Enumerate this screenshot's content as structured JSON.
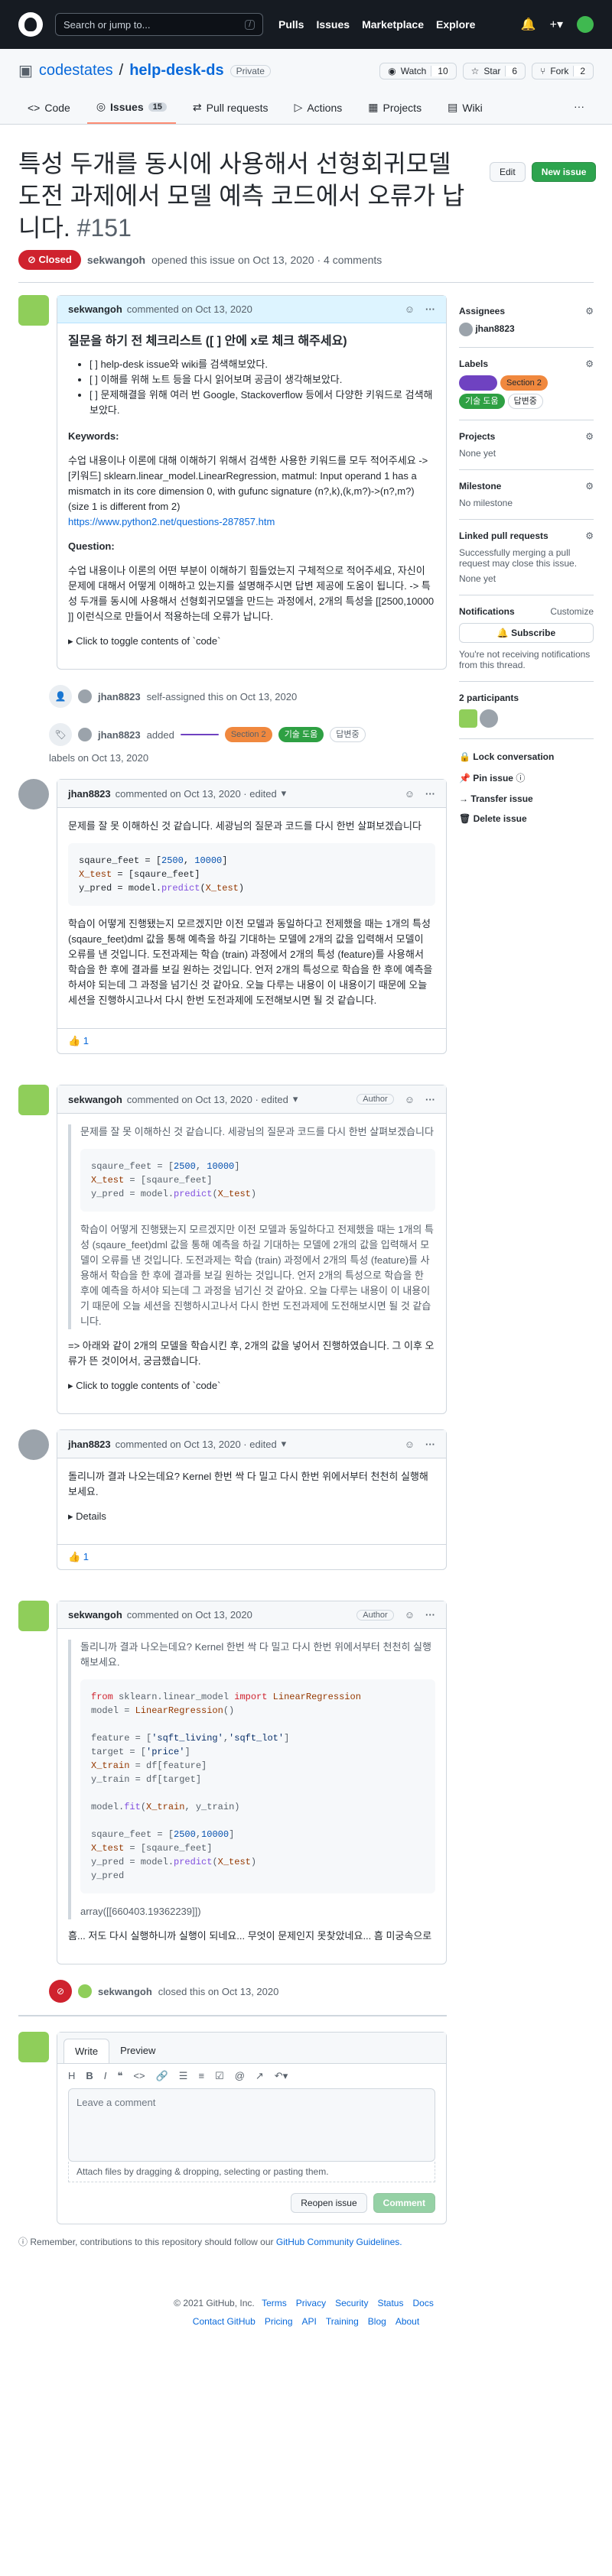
{
  "topnav": {
    "search_placeholder": "Search or jump to...",
    "slash": "/",
    "links": [
      "Pulls",
      "Issues",
      "Marketplace",
      "Explore"
    ]
  },
  "repo": {
    "owner": "codestates",
    "sep": "/",
    "name": "help-desk-ds",
    "visibility": "Private",
    "watch": "Watch",
    "watch_count": "10",
    "star": "Star",
    "star_count": "6",
    "fork": "Fork",
    "fork_count": "2"
  },
  "tabs": [
    {
      "label": "Code"
    },
    {
      "label": "Issues",
      "count": "15"
    },
    {
      "label": "Pull requests"
    },
    {
      "label": "Actions"
    },
    {
      "label": "Projects"
    },
    {
      "label": "Wiki"
    }
  ],
  "issue": {
    "title": "특성 두개를 동시에 사용해서 선형회귀모델 도전 과제에서 모델 예측 코드에서 오류가 납니다.",
    "number": "#151",
    "state": "Closed",
    "author": "sekwangoh",
    "meta": "opened this issue on Oct 13, 2020 · 4 comments",
    "edit": "Edit",
    "new_issue": "New issue"
  },
  "c1": {
    "author": "sekwangoh",
    "date": "commented on Oct 13, 2020",
    "h": "질문을 하기 전 체크리스트 ([ ] 안에 x로 체크 해주세요)",
    "checks": [
      "[ ] help-desk issue와 wiki를 검색해보았다.",
      "[ ] 이해를 위해 노트 등을 다시 읽어보며 공금이 생각해보았다.",
      "[ ] 문제해결을 위해 여러 번 Google, Stackoverflow 등에서 다양한 키워드로 검색해보았다."
    ],
    "kw_h": "Keywords:",
    "kw": "수업 내용이나 이론에 대해 이해하기 위해서 검색한 사용한 키워드를 모두 적어주세요 -> [키워드] sklearn.linear_model.LinearRegression, matmul: Input operand 1 has a mismatch in its core dimension 0, with gufunc signature (n?,k),(k,m?)->(n?,m?) (size 1 is different from 2)",
    "link": "https://www.python2.net/questions-287857.htm",
    "q_h": "Question:",
    "q": "수업 내용이나 이론의 어떤 부분이 이해하기 힘들었는지 구체적으로 적어주세요, 자신이 문제에 대해서 어떻게 이해하고 있는지를 설명해주시면 답변 제공에 도움이 됩니다. -> 특성 두개를 동시에 사용해서 선형회귀모델을 만드는 과정에서, 2개의 특성을 [[2500,10000 ]] 이런식으로 만들어서 적용하는데 오류가 납니다.",
    "toggle": "Click to toggle contents of `code`"
  },
  "e1": {
    "user": "jhan8823",
    "text": "self-assigned this on Oct 13, 2020"
  },
  "e2": {
    "user": "jhan8823",
    "added": "added",
    "labels": [
      {
        "name": "",
        "color": "#6f42c1",
        "fg": "#fff"
      },
      {
        "name": "Section 2",
        "color": "#f0883e",
        "fg": "#24292f"
      },
      {
        "name": "기술 도움",
        "color": "#2ea043",
        "fg": "#fff"
      },
      {
        "name": "답변중",
        "color": "#eaeef2",
        "fg": "#24292f"
      }
    ],
    "tail": "labels on Oct 13, 2020"
  },
  "c2": {
    "author": "jhan8823",
    "date": "commented on Oct 13, 2020 · edited",
    "p1": "문제를 잘 못 이해하신 것 같습니다. 세광님의 질문과 코드를 다시 한번 살펴보겠습니다",
    "p2": "학습이 어떻게 진행됐는지 모르겠지만 이전 모델과 동일하다고 전제했을 때는 1개의 특성 (sqaure_feet)dml 값을 통해 예측을 하길 기대하는 모델에 2개의 값을 입력해서 모델이 오류를 낸 것입니다. 도전과제는 학습 (train) 과정에서 2개의 특성 (feature)를 사용해서 학습을 한 후에 결과를 보길 원하는 것입니다. 언저 2개의 특성으로 학습을 한 후에 예측을 하셔야 되는데 그 과정을 넘기신 것 같아요. 오늘 다루는 내용이 이 내용이기 때문에 오늘 세션을 진행하시고나서 다시 한번 도전과제에 도전해보시면 될 것 같습니다.",
    "react": "👍 1"
  },
  "c3": {
    "author": "sekwangoh",
    "date": "commented on Oct 13, 2020 · edited",
    "author_badge": "Author",
    "p": "=> 아래와 같이 2개의 모델을 학습시킨 후, 2개의 값을 넣어서 진행하였습니다. 그 이후 오류가 뜬 것이어서, 궁금했습니다.",
    "toggle": "Click to toggle contents of `code`"
  },
  "c4": {
    "author": "jhan8823",
    "date": "commented on Oct 13, 2020 · edited",
    "p": "돌리니까 결과 나오는데요? Kernel 한번 싹 다 밀고 다시 한번 위에서부터 천천히 실행해보세요.",
    "details": "Details",
    "react": "👍 1"
  },
  "c5": {
    "author": "sekwangoh",
    "date": "commented on Oct 13, 2020",
    "author_badge": "Author",
    "out1": "array([[660403.19362239]])",
    "out2": "흠... 저도 다시 실행하니까 실행이 되네요... 무엇이 문제인지 못찾았네요... 흠 미궁속으로"
  },
  "e3": {
    "user": "sekwangoh",
    "text": "closed this on Oct 13, 2020"
  },
  "editor": {
    "write": "Write",
    "preview": "Preview",
    "placeholder": "Leave a comment",
    "attach": "Attach files by dragging & dropping, selecting or pasting them.",
    "reopen": "Reopen issue",
    "comment": "Comment",
    "reminder": "Remember, contributions to this repository should follow our",
    "guidelines": "GitHub Community Guidelines."
  },
  "side": {
    "assignees": "Assignees",
    "assignee": "jhan8823",
    "labels": "Labels",
    "projects": "Projects",
    "none_yet": "None yet",
    "milestone": "Milestone",
    "no_milestone": "No milestone",
    "linked": "Linked pull requests",
    "linked_text": "Successfully merging a pull request may close this issue.",
    "linked_none": "None yet",
    "notifications": "Notifications",
    "customize": "Customize",
    "subscribe": "Subscribe",
    "notif_text": "You're not receiving notifications from this thread.",
    "participants": "2 participants",
    "lock": "Lock conversation",
    "pin": "Pin issue",
    "transfer": "Transfer issue",
    "delete": "Delete issue"
  },
  "footer": {
    "copy": "© 2021 GitHub, Inc.",
    "row1": [
      "Terms",
      "Privacy",
      "Security",
      "Status",
      "Docs"
    ],
    "row2": [
      "Contact GitHub",
      "Pricing",
      "API",
      "Training",
      "Blog",
      "About"
    ]
  }
}
